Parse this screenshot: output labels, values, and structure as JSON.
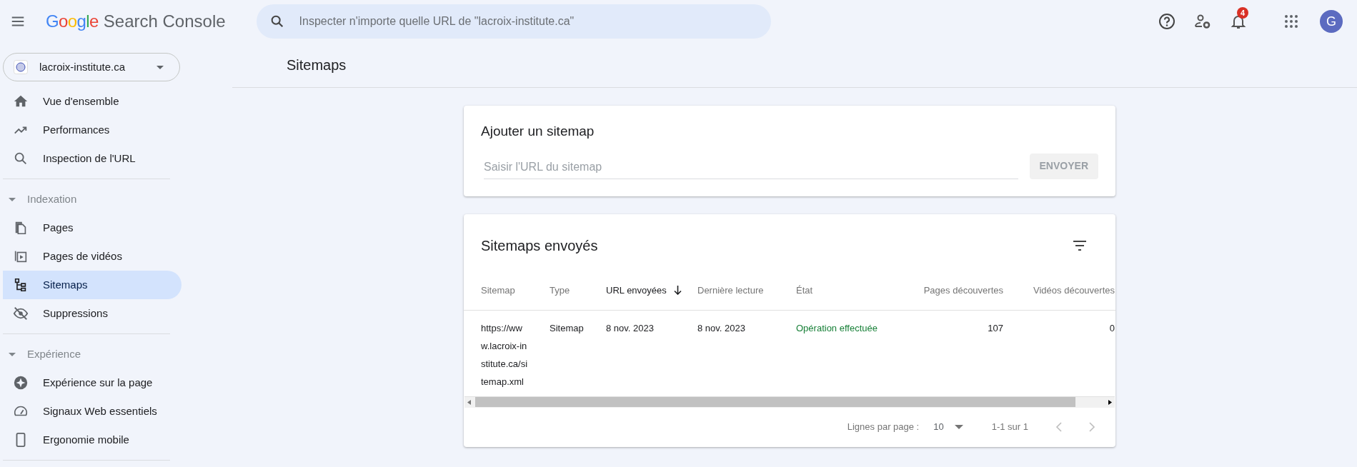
{
  "app": {
    "brand": "Google",
    "title": "Search Console"
  },
  "search": {
    "placeholder": "Inspecter n'importe quelle URL de \"lacroix-institute.ca\""
  },
  "notifications": {
    "count": "4"
  },
  "account": {
    "initial": "G"
  },
  "property": {
    "label": "lacroix-institute.ca"
  },
  "sidebar": {
    "groups": [
      {
        "items": [
          {
            "label": "Vue d'ensemble",
            "selected": false
          },
          {
            "label": "Performances",
            "selected": false
          },
          {
            "label": "Inspection de l'URL",
            "selected": false
          }
        ]
      },
      {
        "header": "Indexation",
        "expanded": true,
        "items": [
          {
            "label": "Pages",
            "selected": false
          },
          {
            "label": "Pages de vidéos",
            "selected": false
          },
          {
            "label": "Sitemaps",
            "selected": true
          },
          {
            "label": "Suppressions",
            "selected": false
          }
        ]
      },
      {
        "header": "Expérience",
        "expanded": true,
        "items": [
          {
            "label": "Expérience sur la page",
            "selected": false
          },
          {
            "label": "Signaux Web essentiels",
            "selected": false
          },
          {
            "label": "Ergonomie mobile",
            "selected": false
          }
        ]
      }
    ]
  },
  "page": {
    "title": "Sitemaps"
  },
  "add_card": {
    "title": "Ajouter un sitemap",
    "placeholder": "Saisir l'URL du sitemap",
    "button": {
      "label": "ENVOYER",
      "disabled": true
    }
  },
  "table_card": {
    "title": "Sitemaps envoyés",
    "columns": [
      {
        "label": "Sitemap",
        "sorted": false
      },
      {
        "label": "Type",
        "sorted": false
      },
      {
        "label": "URL envoyées",
        "sorted": true
      },
      {
        "label": "Dernière lecture",
        "sorted": false
      },
      {
        "label": "État",
        "sorted": false
      },
      {
        "label": "Pages découvertes",
        "sorted": false
      },
      {
        "label": "Vidéos découvertes",
        "sorted": false
      }
    ],
    "rows": [
      {
        "cells": [
          "https://www.lacroix-institute.ca/sitemap.xml",
          "Sitemap",
          "8 nov. 2023",
          "8 nov. 2023",
          "Opération effectuée",
          "107",
          "0"
        ]
      }
    ],
    "pagination": {
      "rows_label": "Lignes par page :",
      "rows_value": "10",
      "range": "1-1 sur 1"
    }
  }
}
